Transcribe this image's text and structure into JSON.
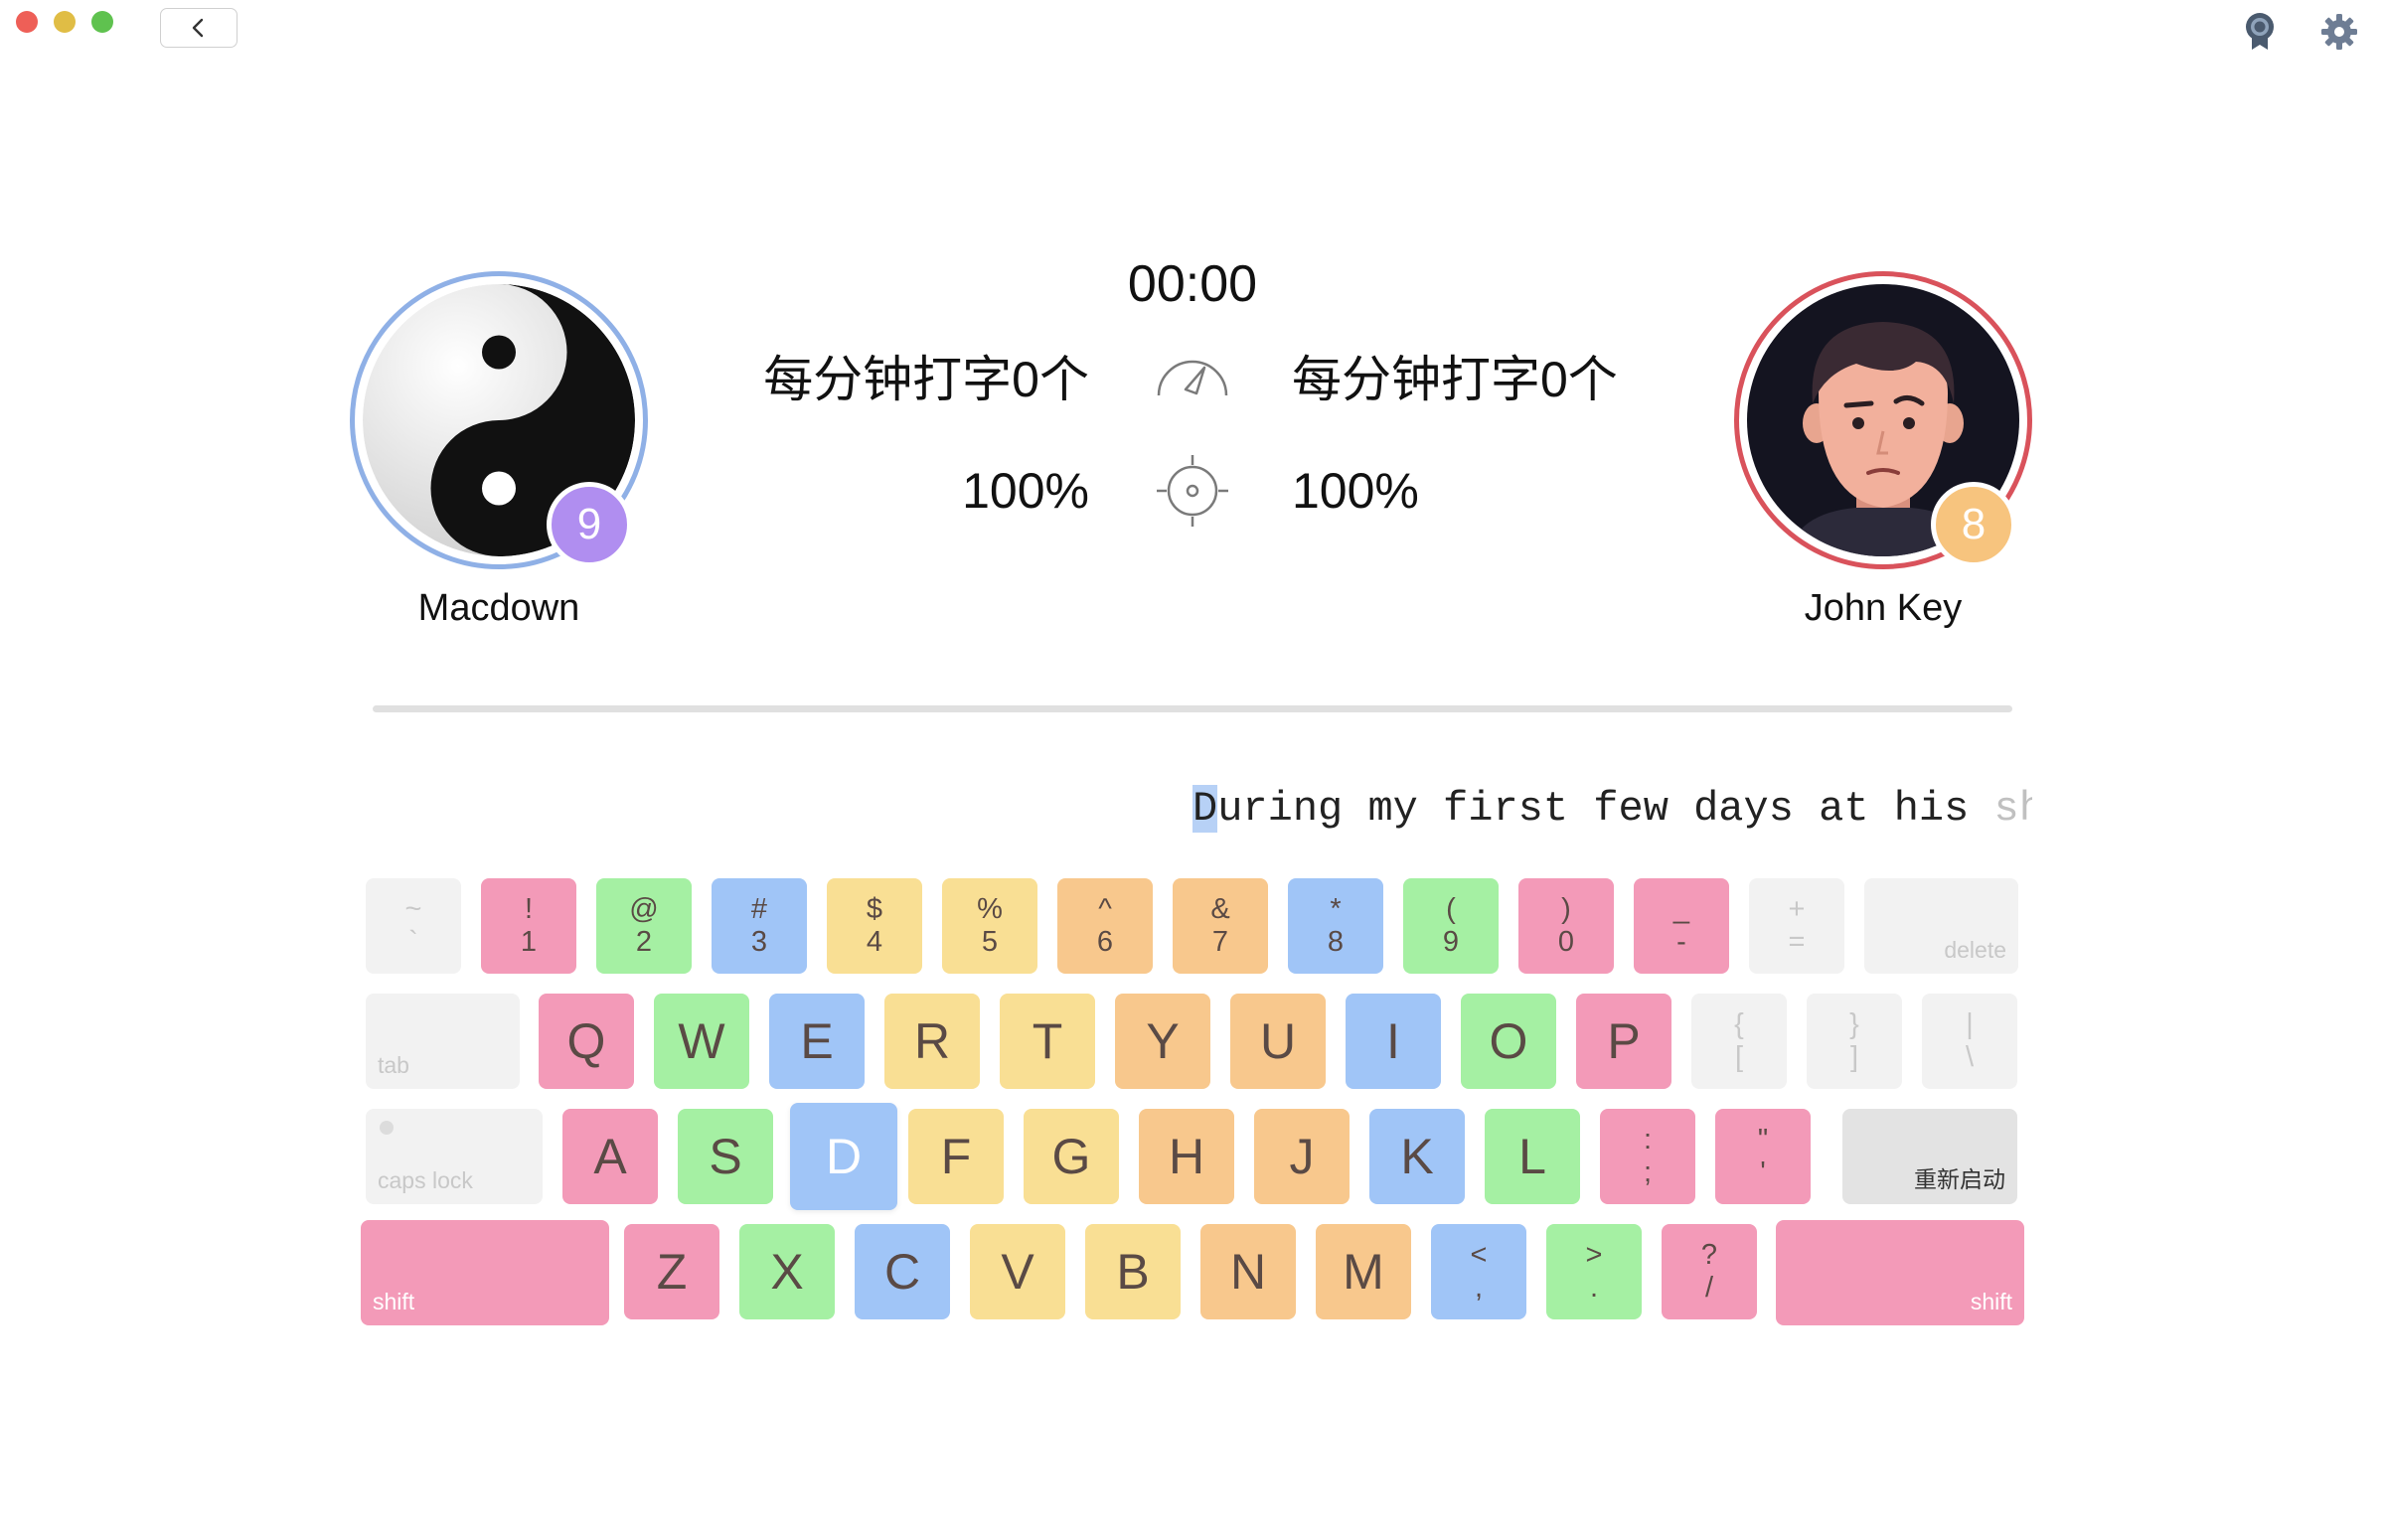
{
  "window": {
    "back_icon": "chevron-left-icon",
    "top_icons": [
      "award-badge-icon",
      "gear-icon"
    ]
  },
  "players": {
    "left": {
      "name": "Macdown",
      "level": "9",
      "avatar": "yin-yang-avatar",
      "ring_color": "#8fb0e6",
      "badge_color": "#b08ef0"
    },
    "right": {
      "name": "John Key",
      "level": "8",
      "avatar": "man-portrait-avatar",
      "ring_color": "#d9525b",
      "badge_color": "#f7c47e"
    }
  },
  "stats": {
    "timer": "00:00",
    "left_wpm": "每分钟打字0个",
    "right_wpm": "每分钟打字0个",
    "left_accuracy": "100%",
    "right_accuracy": "100%",
    "speed_icon": "speedometer-icon",
    "accuracy_icon": "target-icon"
  },
  "typing": {
    "current_char": "D",
    "typed_after_cursor": "uring my first few days at his ",
    "faded_tail": "sho"
  },
  "keyboard": {
    "colors": {
      "pink": "#f39ab8",
      "green": "#a5f0a3",
      "blue": "#a0c5f7",
      "yellow": "#f9df94",
      "orange": "#f8c88d",
      "gray": "#f2f2f2"
    },
    "highlighted_key": "D",
    "row1": [
      {
        "top": "~",
        "bottom": "`"
      },
      {
        "top": "!",
        "bottom": "1"
      },
      {
        "top": "@",
        "bottom": "2"
      },
      {
        "top": "#",
        "bottom": "3"
      },
      {
        "top": "$",
        "bottom": "4"
      },
      {
        "top": "%",
        "bottom": "5"
      },
      {
        "top": "^",
        "bottom": "6"
      },
      {
        "top": "&",
        "bottom": "7"
      },
      {
        "top": "*",
        "bottom": "8"
      },
      {
        "top": "(",
        "bottom": "9"
      },
      {
        "top": ")",
        "bottom": "0"
      },
      {
        "top": "_",
        "bottom": "-"
      },
      {
        "top": "+",
        "bottom": "="
      }
    ],
    "delete_label": "delete",
    "tab_label": "tab",
    "row2": [
      "Q",
      "W",
      "E",
      "R",
      "T",
      "Y",
      "U",
      "I",
      "O",
      "P"
    ],
    "row2_symbols": [
      {
        "top": "{",
        "bottom": "["
      },
      {
        "top": "}",
        "bottom": "]"
      },
      {
        "top": "|",
        "bottom": "\\"
      }
    ],
    "caps_label": "caps lock",
    "row3": [
      "A",
      "S",
      "D",
      "F",
      "G",
      "H",
      "J",
      "K",
      "L"
    ],
    "row3_symbols": [
      {
        "top": ":",
        "bottom": ";"
      },
      {
        "top": "\"",
        "bottom": "'"
      }
    ],
    "restart_label": "重新启动",
    "shift_label": "shift",
    "row4": [
      "Z",
      "X",
      "C",
      "V",
      "B",
      "N",
      "M"
    ],
    "row4_symbols": [
      {
        "top": "<",
        "bottom": ","
      },
      {
        "top": ">",
        "bottom": "."
      },
      {
        "top": "?",
        "bottom": "/"
      }
    ]
  }
}
